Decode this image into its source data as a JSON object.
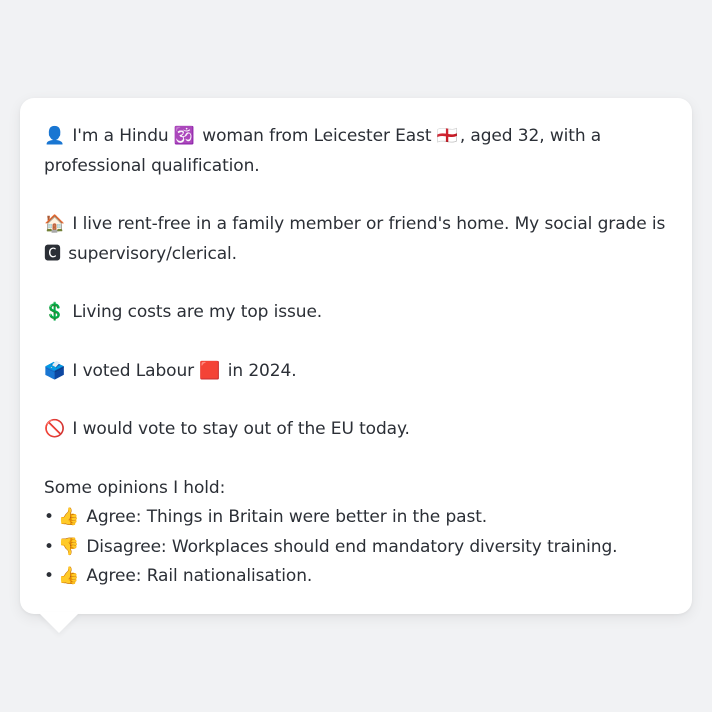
{
  "persona": {
    "line1_emoji": "👤",
    "line1_a": " I'm a Hindu ",
    "line1_religion_emoji": "🕉️",
    "line1_b": " woman from Leicester East ",
    "line1_flag_emoji": "🏴󠁧󠁢󠁥󠁮󠁧󠁿",
    "line1_c": ", aged 32, with a professional qualification.",
    "line2_emoji": "🏠",
    "line2_a": " I live rent-free in a family member or friend's home. My social grade is ",
    "line2_grade_emoji": "🅲",
    "line2_b": " supervisory/clerical.",
    "line3_emoji": "💲",
    "line3_text": " Living costs are my top issue.",
    "line4_emoji": "🗳️",
    "line4_a": " I voted Labour ",
    "line4_party_emoji": "🟥",
    "line4_b": " in 2024.",
    "line5_emoji": "🚫",
    "line5_text": " I would vote to stay out of the EU today."
  },
  "opinions": {
    "heading": "Some opinions I hold:",
    "bullet": "•",
    "items": [
      {
        "emoji": "👍",
        "text": " Agree: Things in Britain were better in the past."
      },
      {
        "emoji": "👎",
        "text": " Disagree: Workplaces should end mandatory diversity training."
      },
      {
        "emoji": "👍",
        "text": " Agree: Rail nationalisation."
      }
    ]
  },
  "colors": {
    "background": "#f1f2f4",
    "card": "#ffffff",
    "text": "#2b2f36"
  }
}
